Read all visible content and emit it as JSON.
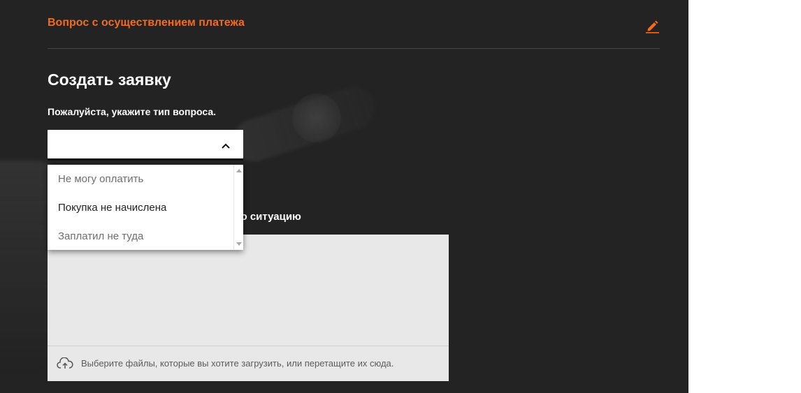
{
  "header": {
    "topic_title": "Вопрос с осуществлением платежа",
    "edit_icon": "pencil-icon"
  },
  "form": {
    "title": "Создать заявку",
    "question_type_label": "Пожалуйста, укажите тип вопроса.",
    "question_type_value": "",
    "question_type_options": [
      "Не могу оплатить",
      "Покупка не начислена",
      "Заплатил не туда"
    ],
    "describe_label_visible": "шую ситуацию",
    "description_value": "",
    "upload_text": "Выберите файлы, которые вы хотите загрузить, или перетащите их сюда.",
    "upload_icon": "cloud-upload-icon"
  },
  "colors": {
    "accent": "#f26b21",
    "panel_bg": "#232323",
    "field_bg": "#e8e8e8"
  }
}
